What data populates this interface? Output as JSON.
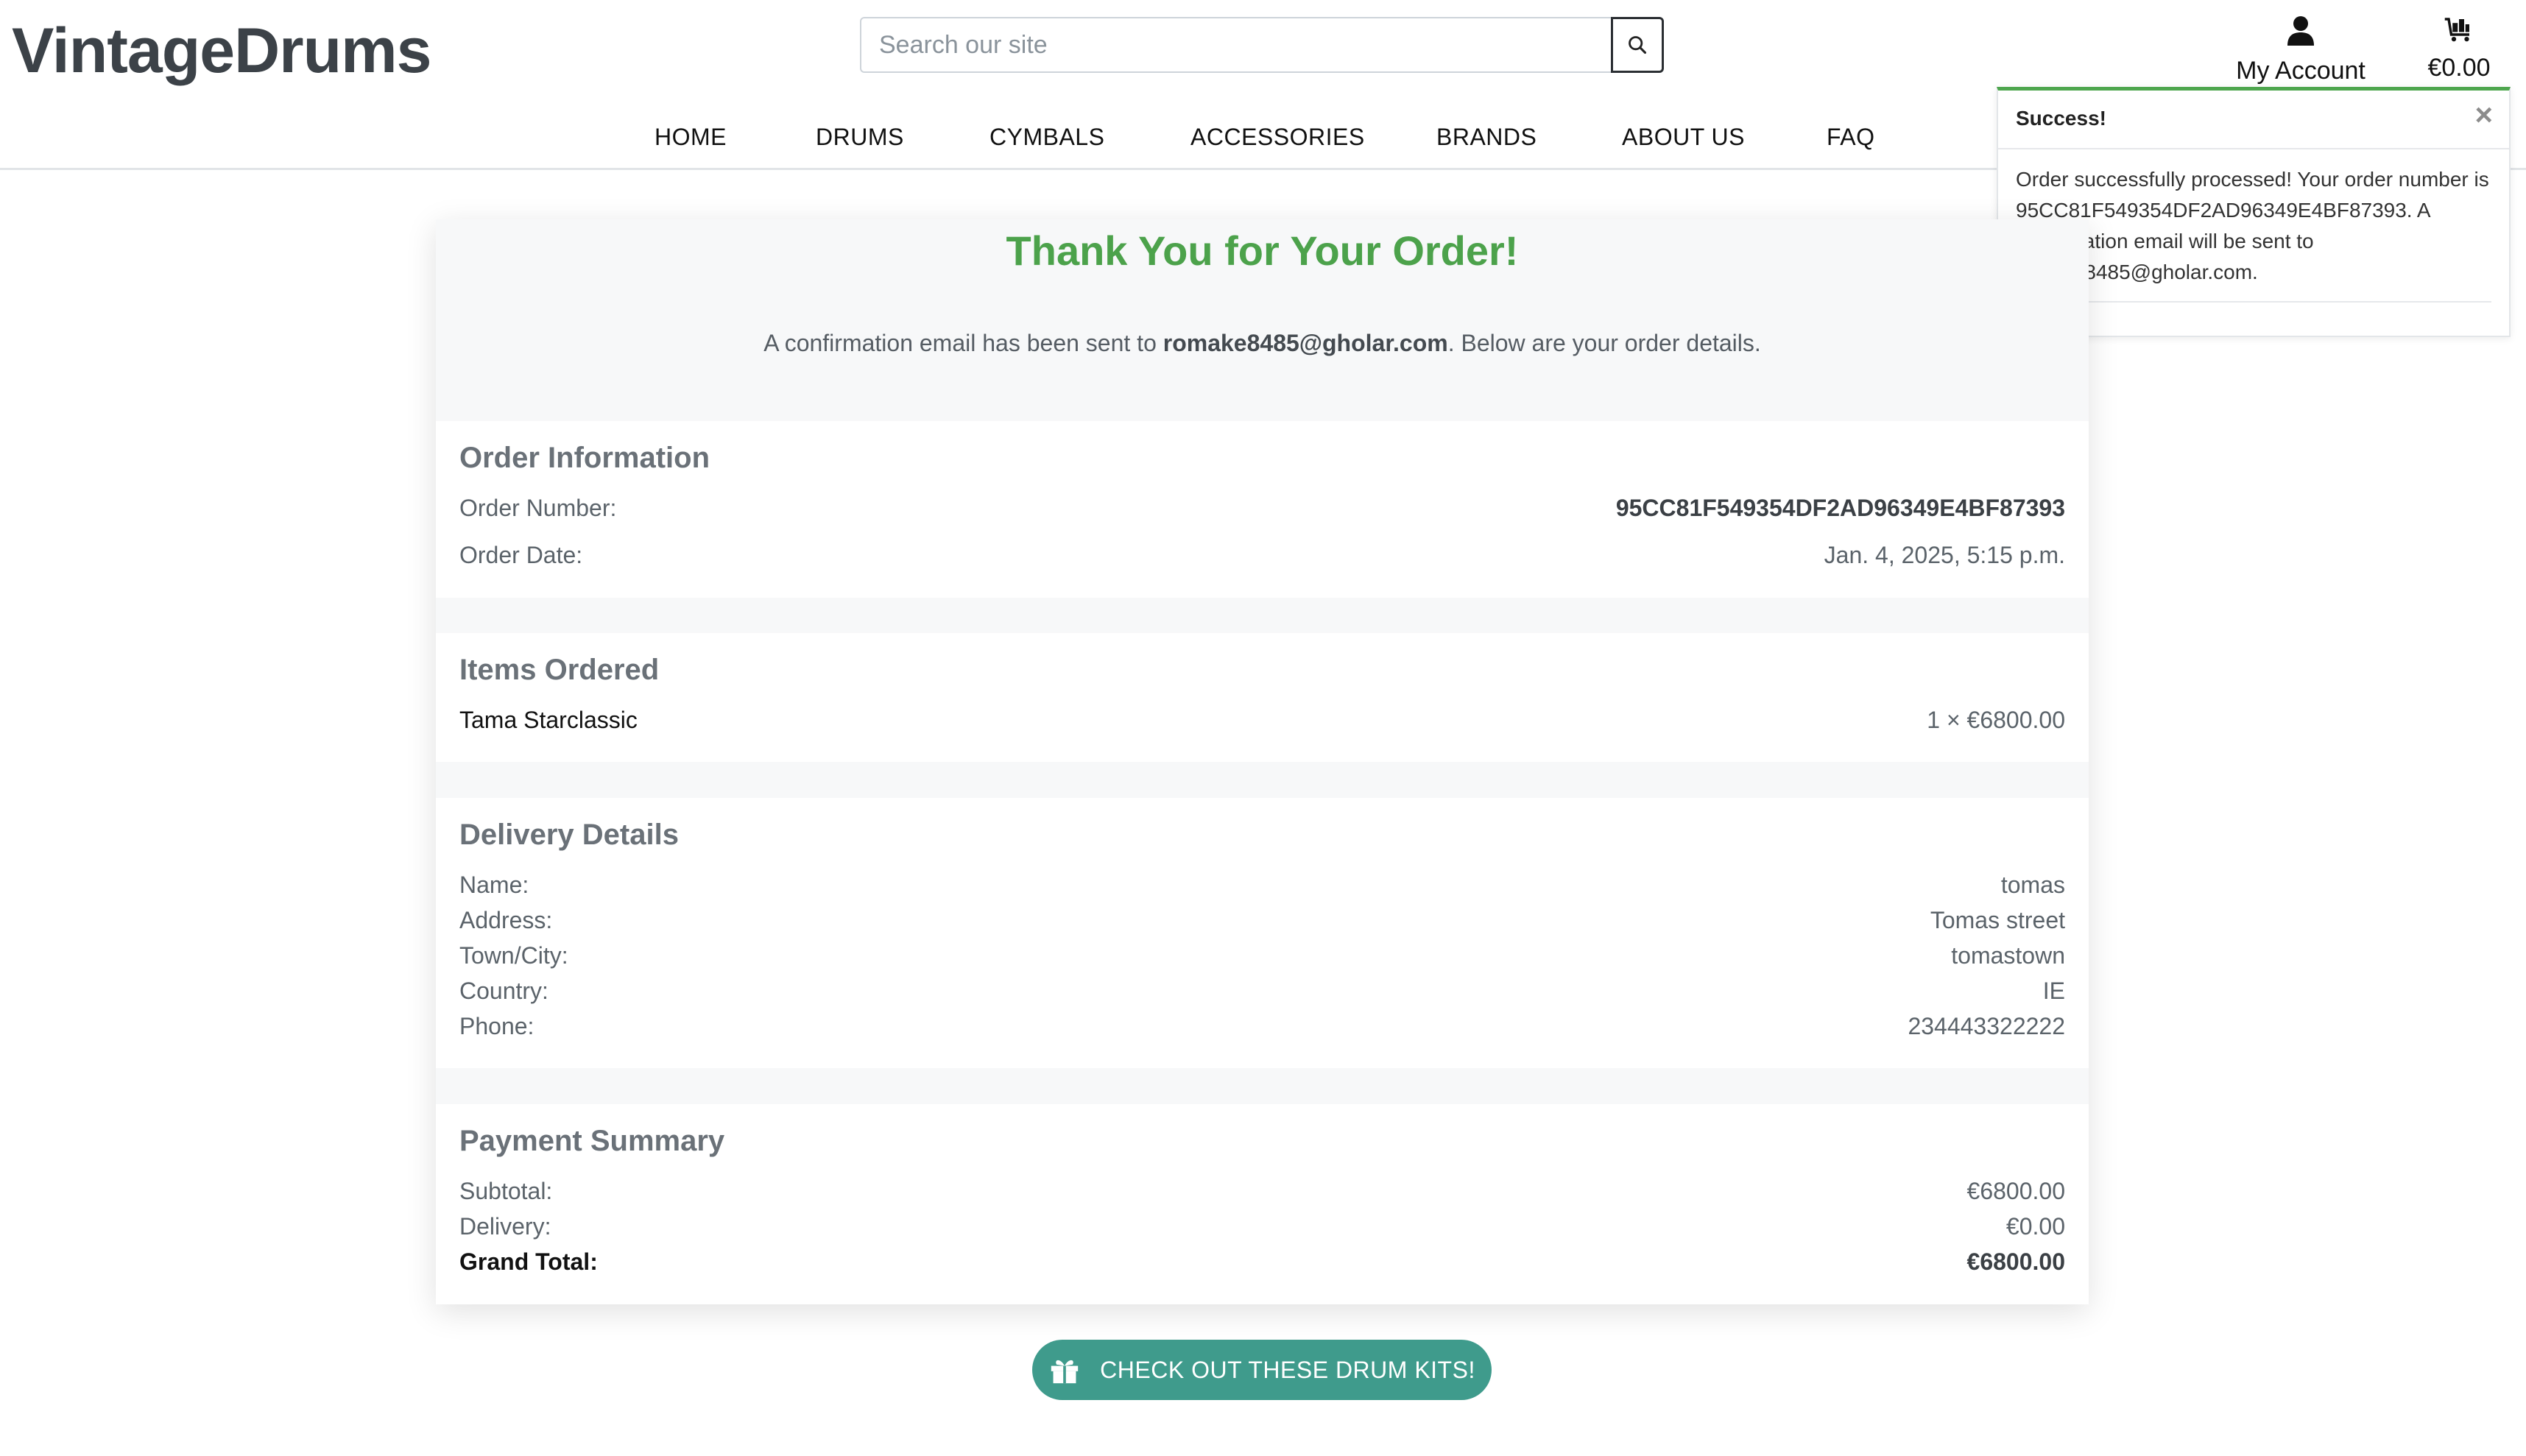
{
  "header": {
    "logo": "VintageDrums",
    "search_placeholder": "Search our site",
    "account_label": "My Account",
    "cart_total": "€0.00"
  },
  "nav": {
    "items": [
      "HOME",
      "DRUMS",
      "CYMBALS",
      "ACCESSORIES",
      "BRANDS",
      "ABOUT US",
      "FAQ"
    ]
  },
  "toast": {
    "title": "Success!",
    "close": "×",
    "message_line1": "Order successfully processed! Your order number is",
    "message_line2": "95CC81F549354DF2AD96349E4BF87393. A",
    "message_line3": "confirmation email will be sent to",
    "message_line4": "romake8485@gholar.com."
  },
  "confirmation": {
    "title": "Thank You for Your Order!",
    "sub_prefix": "A confirmation email has been sent to ",
    "email": "romake8485@gholar.com",
    "sub_suffix": ". Below are your order details."
  },
  "order_info": {
    "heading": "Order Information",
    "order_number_label": "Order Number:",
    "order_number": "95CC81F549354DF2AD96349E4BF87393",
    "order_date_label": "Order Date:",
    "order_date": "Jan. 4, 2025, 5:15 p.m."
  },
  "items": {
    "heading": "Items Ordered",
    "list": [
      {
        "name": "Tama Starclassic",
        "qty_price": "1 × €6800.00"
      }
    ]
  },
  "delivery": {
    "heading": "Delivery Details",
    "name_label": "Name:",
    "name": "tomas",
    "address_label": "Address:",
    "address": "Tomas street",
    "town_label": "Town/City:",
    "town": "tomastown",
    "country_label": "Country:",
    "country": "IE",
    "phone_label": "Phone:",
    "phone": "234443322222"
  },
  "payment": {
    "heading": "Payment Summary",
    "subtotal_label": "Subtotal:",
    "subtotal": "€6800.00",
    "delivery_label": "Delivery:",
    "delivery": "€0.00",
    "grand_label": "Grand Total:",
    "grand": "€6800.00"
  },
  "cta": {
    "label": "CHECK OUT THESE DRUM KITS!"
  },
  "colors": {
    "accent_green": "#4ca24b",
    "cta_teal": "#3f9b8c",
    "toast_border": "#4ea64e"
  },
  "icons": [
    "search-icon",
    "user-icon",
    "cart-icon",
    "close-icon",
    "gift-icon"
  ]
}
